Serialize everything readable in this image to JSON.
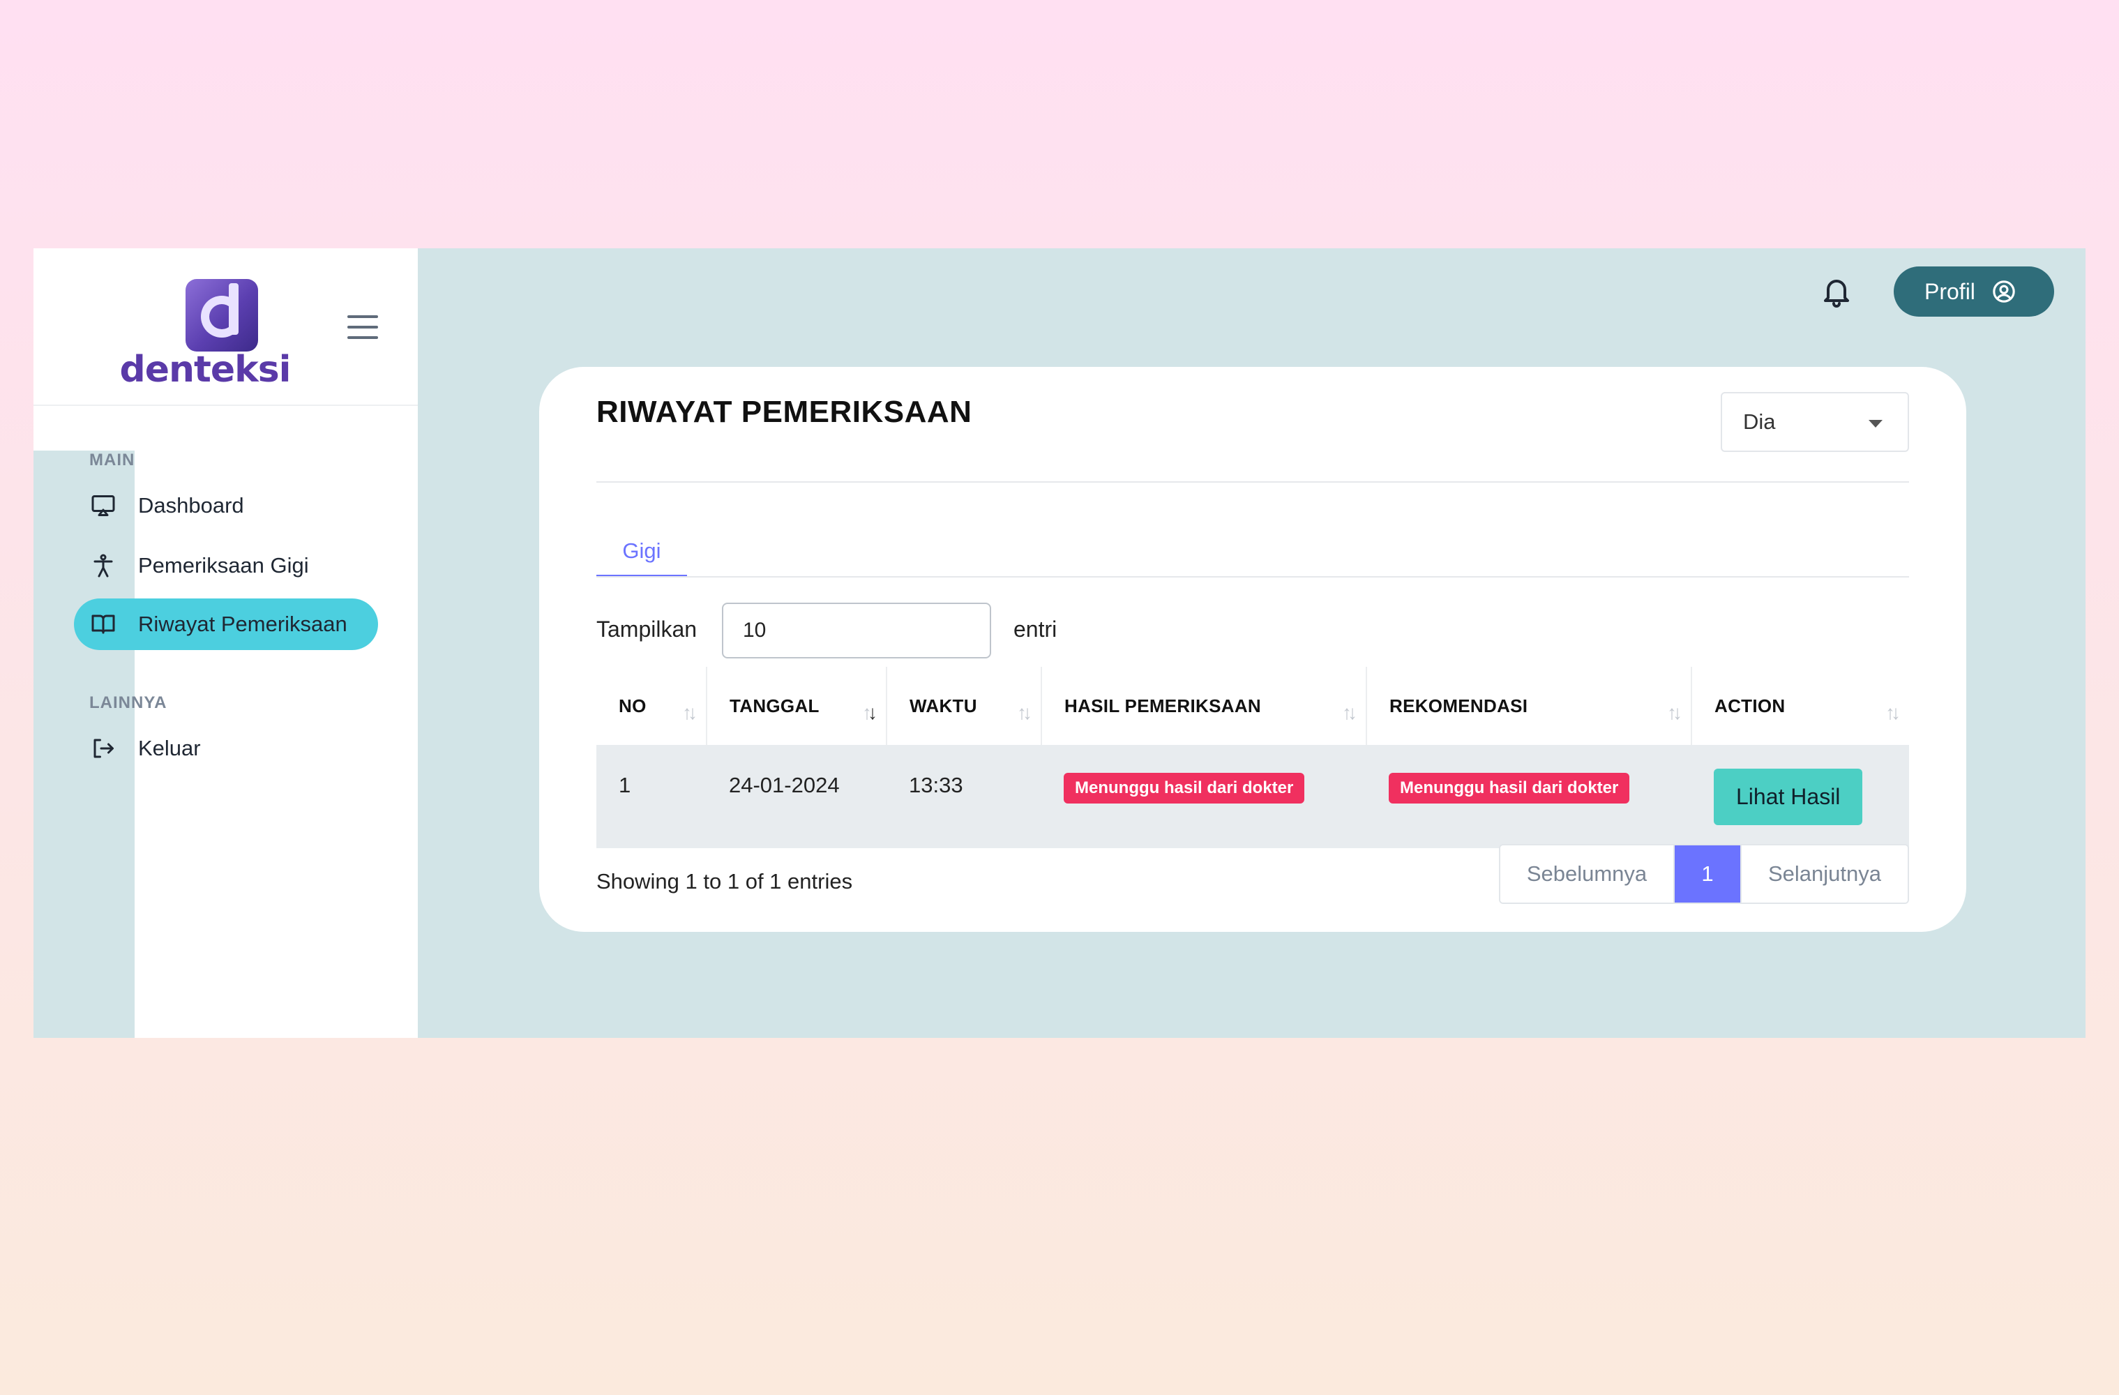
{
  "brand": {
    "name": "denteksi"
  },
  "sidebar": {
    "sections": [
      {
        "label": "MAIN"
      },
      {
        "label": "LAINNYA"
      }
    ],
    "items": [
      {
        "label": "Dashboard",
        "icon": "monitor-icon"
      },
      {
        "label": "Pemeriksaan Gigi",
        "icon": "person-icon"
      },
      {
        "label": "Riwayat Pemeriksaan",
        "icon": "book-icon",
        "active": true
      },
      {
        "label": "Keluar",
        "icon": "logout-icon"
      }
    ]
  },
  "topbar": {
    "profile_label": "Profil"
  },
  "card": {
    "title": "RIWAYAT PEMERIKSAAN",
    "select_value": "Dia",
    "tabs": [
      {
        "label": "Gigi",
        "active": true
      }
    ],
    "length": {
      "prefix": "Tampilkan",
      "value": "10",
      "suffix": "entri"
    },
    "table": {
      "headers": [
        "NO",
        "TANGGAL",
        "WAKTU",
        "HASIL PEMERIKSAAN",
        "REKOMENDASI",
        "ACTION"
      ],
      "rows": [
        {
          "no": "1",
          "tanggal": "24-01-2024",
          "waktu": "13:33",
          "hasil": "Menunggu hasil dari dokter",
          "rekomendasi": "Menunggu hasil dari dokter",
          "action": "Lihat Hasil"
        }
      ]
    },
    "info": "Showing 1 to 1 of 1 entries",
    "pagination": {
      "prev": "Sebelumnya",
      "current": "1",
      "next": "Selanjutnya"
    }
  },
  "colors": {
    "accent": "#4ccfdf",
    "primary": "#6b73ff",
    "badge": "#f0305f",
    "profile_button": "#2f6d7a",
    "main_bg": "#d2e4e7"
  }
}
